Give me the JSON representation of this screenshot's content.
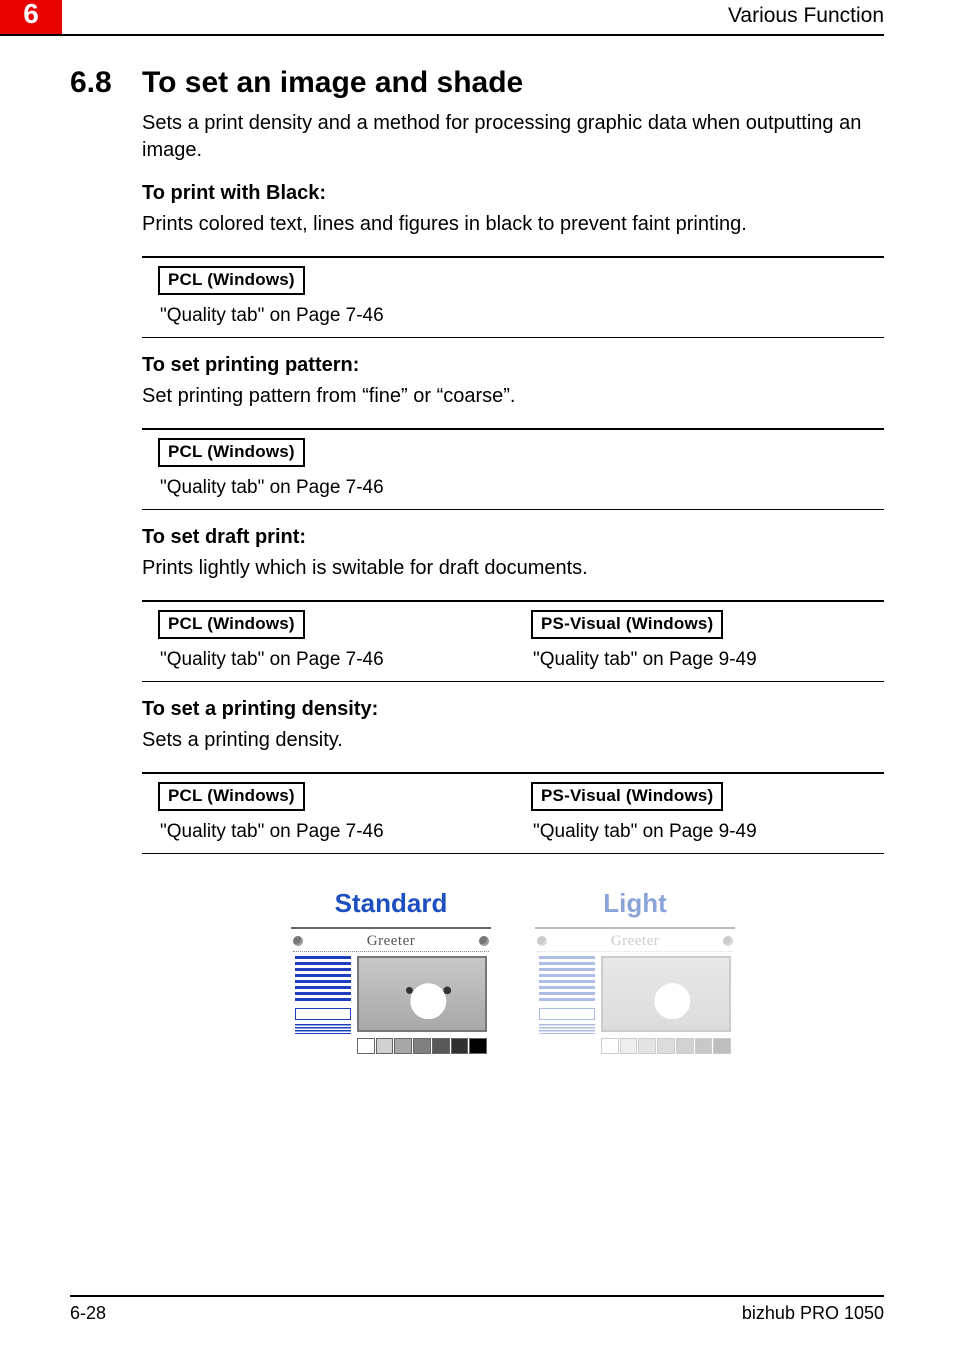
{
  "chapter_number": "6",
  "running_header": "Various Function",
  "section": {
    "number": "6.8",
    "title": "To set an image and shade",
    "intro": "Sets a print density and a method for processing graphic data when outputting an image."
  },
  "blocks": [
    {
      "heading": "To print with Black:",
      "desc": "Prints colored text, lines and figures in black to prevent faint printing.",
      "drivers": [
        {
          "label": "PCL (Windows)",
          "ref": "\"Quality tab\" on Page 7-46"
        }
      ]
    },
    {
      "heading": "To set printing pattern:",
      "desc": "Set printing pattern from “fine” or “coarse”.",
      "drivers": [
        {
          "label": "PCL (Windows)",
          "ref": "\"Quality tab\" on Page 7-46"
        }
      ]
    },
    {
      "heading": "To set draft print:",
      "desc": "Prints lightly which is switable for draft documents.",
      "drivers": [
        {
          "label": "PCL (Windows)",
          "ref": "\"Quality tab\" on Page 7-46"
        },
        {
          "label": "PS-Visual (Windows)",
          "ref": "\"Quality tab\" on Page 9-49"
        }
      ]
    },
    {
      "heading": "To set a printing density:",
      "desc": "Sets a printing density.",
      "drivers": [
        {
          "label": "PCL (Windows)",
          "ref": "\"Quality tab\" on Page 7-46"
        },
        {
          "label": "PS-Visual (Windows)",
          "ref": "\"Quality tab\" on Page 9-49"
        }
      ]
    }
  ],
  "figure": {
    "left_title": "Standard",
    "right_title": "Light",
    "brand": "Greeter",
    "swatch_colors_std": [
      "#ffffff",
      "#d0d0d0",
      "#a8a8a8",
      "#808080",
      "#585858",
      "#303030",
      "#000000"
    ],
    "swatch_colors_light": [
      "#ffffff",
      "#eeeeee",
      "#e4e4e4",
      "#dcdcdc",
      "#d2d2d2",
      "#c8c8c8",
      "#bebebe"
    ]
  },
  "footer": {
    "left": "6-28",
    "right": "bizhub PRO 1050"
  }
}
